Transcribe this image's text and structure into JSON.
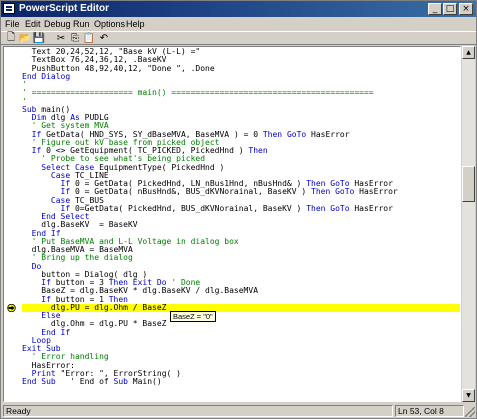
{
  "window": {
    "title": "PowerScript Editor"
  },
  "menu": [
    {
      "id": "file",
      "label": "File"
    },
    {
      "id": "edit",
      "label": "Edit"
    },
    {
      "id": "debug",
      "label": "Debug"
    },
    {
      "id": "run",
      "label": "Run"
    },
    {
      "id": "options",
      "label": "Options"
    },
    {
      "id": "help",
      "label": "Help"
    }
  ],
  "toolbar": [
    {
      "id": "new",
      "icon": "new-document-icon",
      "glyph": "🗋"
    },
    {
      "id": "open",
      "icon": "open-folder-icon",
      "glyph": "📂"
    },
    {
      "id": "save",
      "icon": "save-disk-icon",
      "glyph": "💾"
    },
    {
      "id": "cut",
      "icon": "cut-scissors-icon",
      "glyph": "✂"
    },
    {
      "id": "copy",
      "icon": "copy-icon",
      "glyph": "⎘"
    },
    {
      "id": "paste",
      "icon": "paste-clipboard-icon",
      "glyph": "📋"
    },
    {
      "id": "undo",
      "icon": "undo-icon",
      "glyph": "↶"
    }
  ],
  "code": [
    {
      "t": "  Text 20,24,52,12, \"Base kV (L-L) =\""
    },
    {
      "t": "  TextBox 76,24,36,12, .BaseKV"
    },
    {
      "t": "  PushButton 48,92,40,12, \"Done \", .Done"
    },
    {
      "t": "End Dialog",
      "k": "End Dialog"
    },
    {
      "t": "'",
      "c": true
    },
    {
      "t": "' ===================== main() ==========================================",
      "c": true
    },
    {
      "t": "'",
      "c": true
    },
    {
      "t": "Sub main()",
      "k": "Sub"
    },
    {
      "t": "  Dim dlg As PUDLG",
      "k": "Dim"
    },
    {
      "t": "  ' Get system MVA",
      "c": true
    },
    {
      "t": "  If GetData( HND_SYS, SY_dBaseMVA, BaseMVA ) = 0 Then GoTo HasError",
      "k": "If"
    },
    {
      "t": "  ' Figure out kV base from picked object",
      "c": true
    },
    {
      "t": "  If 0 <> GetEquipment( TC_PICKED, PickedHnd ) Then",
      "k": "If"
    },
    {
      "t": "    ' Probe to see what's being picked",
      "c": true
    },
    {
      "t": "    Select Case EquipmentType( PickedHnd )",
      "k": "Select Case"
    },
    {
      "t": "      Case TC_LINE",
      "k": "Case"
    },
    {
      "t": "        If 0 = GetData( PickedHnd, LN_nBus1Hnd, nBusHnd& ) Then GoTo HasError",
      "k": "If"
    },
    {
      "t": "        If 0 = GetData( nBusHnd&, BUS_dKVNorainal, BaseKV ) Then GoTo HasError",
      "k": "If"
    },
    {
      "t": "      Case TC_BUS",
      "k": "Case"
    },
    {
      "t": "        If 0=GetData( PickedHnd, BUS_dKVNorainal, BaseKV ) Then GoTo HasError",
      "k": "If"
    },
    {
      "t": "    End Select",
      "k": "End Select"
    },
    {
      "t": "    dlg.BaseKV  = BaseKV"
    },
    {
      "t": "  End If",
      "k": "End If"
    },
    {
      "t": "  ' Put BaseMVA and L-L Voltage in dialog box",
      "c": true
    },
    {
      "t": "  dlg.BaseMVA = BaseMVA"
    },
    {
      "t": "  ' Bring up the dialog",
      "c": true
    },
    {
      "t": "  Do",
      "k": "Do"
    },
    {
      "t": "    button = Dialog( dlg )"
    },
    {
      "t": "    If button = 3 Then Exit Do ' Done",
      "k": "If"
    },
    {
      "t": "    BaseZ = dlg.BaseKV * dlg.BaseKV / dlg.BaseMVA"
    },
    {
      "t": "    If button = 1 Then",
      "k": "If"
    },
    {
      "t": "      dlg.PU = dlg.Ohm / BaseZ",
      "hl": true
    },
    {
      "t": "    Else",
      "k": "Else"
    },
    {
      "t": "      dlg.Ohm = dlg.PU * BaseZ"
    },
    {
      "t": "    End If",
      "k": "End If"
    },
    {
      "t": "  Loop",
      "k": "Loop"
    },
    {
      "t": "Exit Sub",
      "k": "Exit Sub"
    },
    {
      "t": "  ' Error handling",
      "c": true
    },
    {
      "t": "  HasError:"
    },
    {
      "t": "  Print \"Error: \", ErrorString( )",
      "k": "Print"
    },
    {
      "t": "End Sub   ' End of Sub Main()",
      "k": "End Sub"
    }
  ],
  "tooltip": "BaseZ = \"0\"",
  "status": {
    "left": "Ready",
    "right": "Ln 53, Col 8"
  }
}
